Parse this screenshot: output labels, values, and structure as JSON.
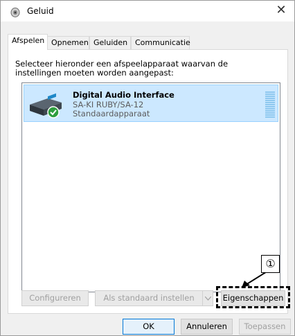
{
  "window": {
    "title": "Geluid"
  },
  "tabs": [
    {
      "label": "Afspelen",
      "active": true
    },
    {
      "label": "Opnemen",
      "active": false
    },
    {
      "label": "Geluiden",
      "active": false
    },
    {
      "label": "Communicatie",
      "active": false
    }
  ],
  "playback": {
    "instruction": "Selecteer hieronder een afspeelapparaat waarvan de instellingen moeten worden aangepast:",
    "devices": [
      {
        "name": "Digital Audio Interface",
        "model": "SA-KI RUBY/SA-12",
        "status": "Standaardapparaat",
        "selected": true,
        "default": true
      }
    ],
    "buttons": {
      "configure": "Configureren",
      "set_default": "Als standaard instellen",
      "properties": "Eigenschappen"
    }
  },
  "annotation": {
    "marker": "①"
  },
  "dialog_buttons": {
    "ok": "OK",
    "cancel": "Annuleren",
    "apply": "Toepassen"
  },
  "colors": {
    "selection": "#cce8ff",
    "selection_border": "#99d1ff",
    "check_green": "#2e9e3e",
    "focus": "#0078d7"
  }
}
